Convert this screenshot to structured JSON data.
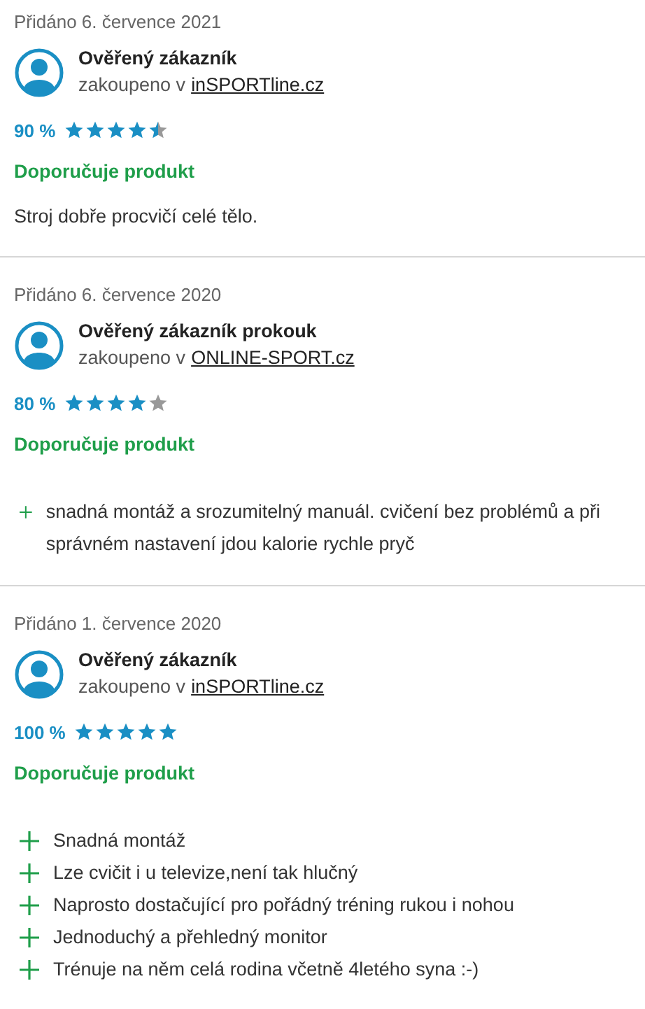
{
  "reviews": [
    {
      "date": "Přidáno 6. července 2021",
      "reviewer": "Ověřený zákazník",
      "store_prefix": "zakoupeno v",
      "store": "inSPORTline.cz",
      "percent": "90 %",
      "stars": 4.5,
      "recommendation": "Doporučuje produkt",
      "text": "Stroj dobře procvičí celé tělo."
    },
    {
      "date": "Přidáno 6. července 2020",
      "reviewer": "Ověřený zákazník prokouk",
      "store_prefix": "zakoupeno v",
      "store": "ONLINE-SPORT.cz",
      "percent": "80 %",
      "stars": 4,
      "recommendation": "Doporučuje produkt",
      "pros": [
        "snadná montáž a srozumitelný manuál. cvičení bez problémů a při správném nastavení jdou kalorie rychle pryč"
      ]
    },
    {
      "date": "Přidáno 1. července 2020",
      "reviewer": "Ověřený zákazník",
      "store_prefix": "zakoupeno v",
      "store": "inSPORTline.cz",
      "percent": "100 %",
      "stars": 5,
      "recommendation": "Doporučuje produkt",
      "pros": [
        "Snadná montáž",
        "Lze cvičit i u televize,není tak hlučný",
        "Naprosto dostačující pro pořádný tréning rukou i nohou",
        "Jednoduchý a přehledný monitor",
        "Trénuje na něm celá rodina včetně 4letého syna :-)"
      ]
    }
  ]
}
